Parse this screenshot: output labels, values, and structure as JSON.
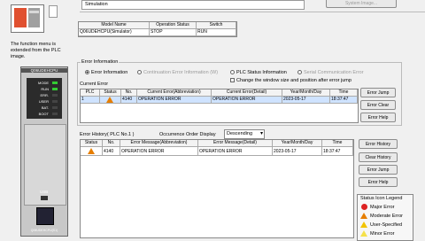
{
  "top": {
    "mode_label": "Simulation",
    "system_image_button": "System Image..."
  },
  "note": {
    "line1": "The function menu is",
    "line2": "extended from the PLC",
    "line3": "image."
  },
  "plc": {
    "model_label": "Q06UDEHCPU",
    "leds": [
      "MODE",
      "RUN",
      "ERR.",
      "USER",
      "BAT.",
      "BOOT"
    ],
    "usb_label": "USB",
    "bottom_label": "Q06UDEHCPU(S1)"
  },
  "model_table": {
    "headers": [
      "Model Name",
      "Operation Status",
      "Switch"
    ],
    "row": [
      "Q06UDEHCPU(Simulator)",
      "STOP",
      "RUN"
    ]
  },
  "error_info": {
    "group_title": "Error Information",
    "radio_error_info": "Error Information",
    "radio_continuation": "Continuation Error Information (W)",
    "radio_plc_status": "PLC Status Information",
    "radio_serial": "Serial Communication Error",
    "checkbox_change_window": "Change the window size and position after error jump",
    "current_error_label": "Current Error",
    "current_headers": [
      "PLC",
      "Status",
      "No.",
      "Current Error(Abbreviation)",
      "Current Error(Detail)",
      "Year/Month/Day",
      "Time"
    ],
    "current_row": [
      "1",
      "",
      "4140",
      "OPERATION ERROR",
      "OPERATION ERROR",
      "2023-05-17",
      "18:37:47"
    ],
    "buttons": [
      "Error Jump",
      "Error Clear",
      "Error Help"
    ]
  },
  "history": {
    "title": "Error History( PLC No.1 )",
    "order_label": "Occurrence Order Display",
    "order_value": "Descending",
    "headers": [
      "Status",
      "No.",
      "Error Message(Abbreviation)",
      "Error Message(Detail)",
      "Year/Month/Day",
      "Time"
    ],
    "row": [
      "",
      "4140",
      "OPERATION ERROR",
      "OPERATION ERROR",
      "2023-05-17",
      "18:37:47"
    ],
    "buttons": [
      "Error History",
      "Clear History",
      "Error Jump",
      "Error Help"
    ]
  },
  "legend": {
    "title": "Status Icon Legend",
    "items": [
      "Major Error",
      "Moderate Error",
      "User-Specified",
      "Minor Error"
    ]
  }
}
